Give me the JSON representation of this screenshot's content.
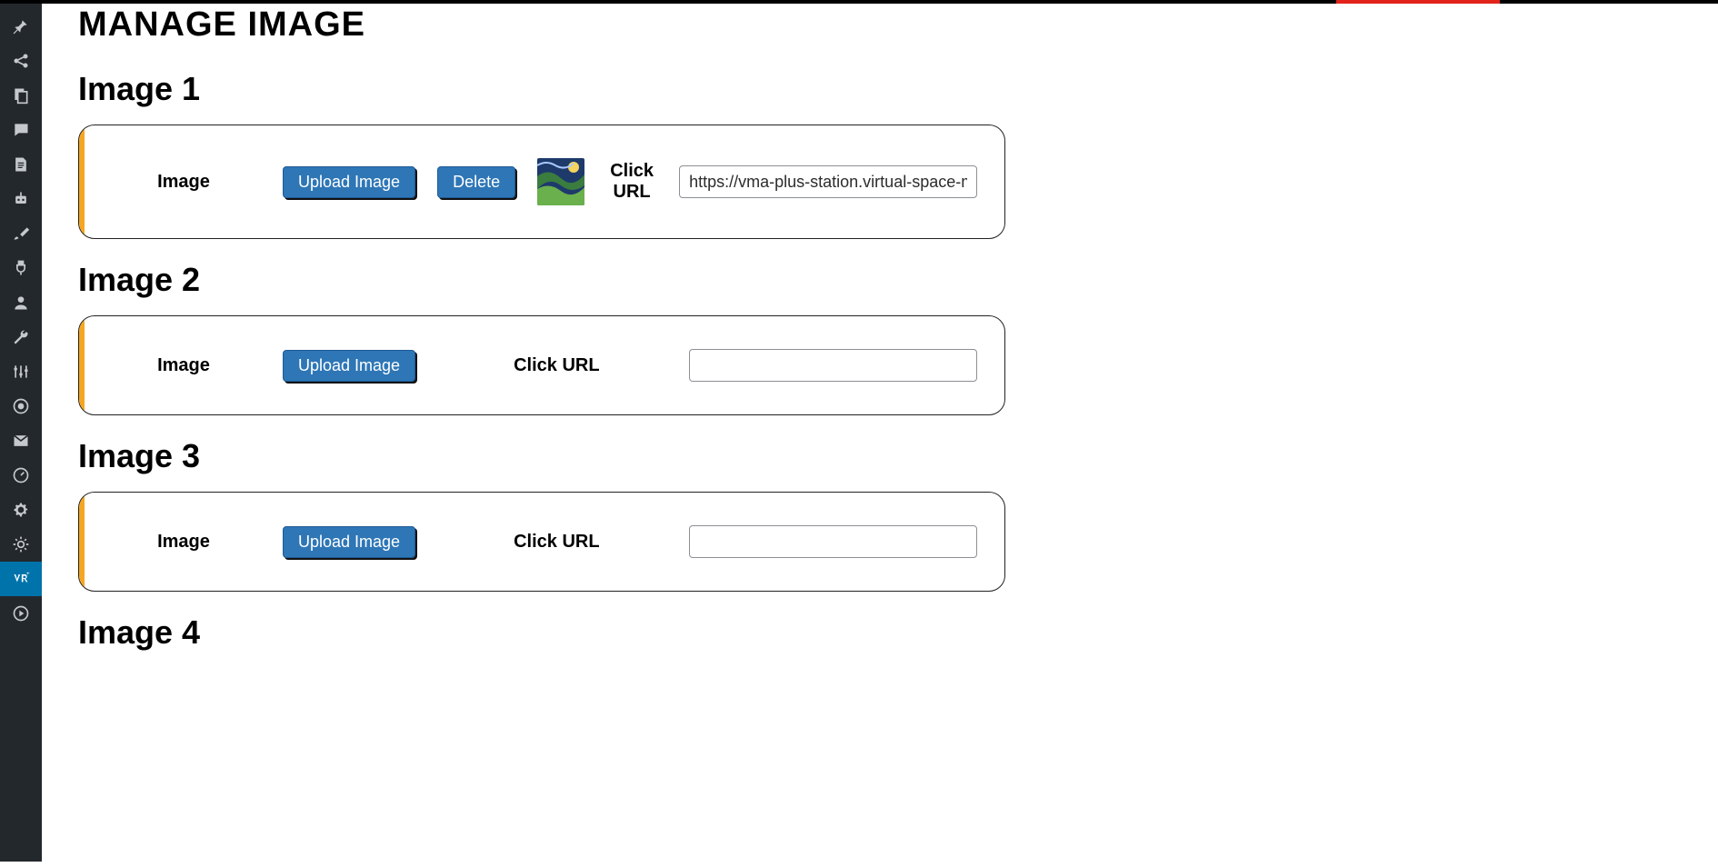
{
  "page": {
    "title": "MANAGE IMAGE"
  },
  "labels": {
    "image": "Image",
    "upload": "Upload Image",
    "delete": "Delete",
    "click_url": "Click URL",
    "click": "Click",
    "url": "URL"
  },
  "sections": [
    {
      "title": "Image 1",
      "has_image": true,
      "url_value": "https://vma-plus-station.virtual-space-marl"
    },
    {
      "title": "Image 2",
      "has_image": false,
      "url_value": ""
    },
    {
      "title": "Image 3",
      "has_image": false,
      "url_value": ""
    },
    {
      "title": "Image 4",
      "has_image": false,
      "url_value": ""
    }
  ],
  "sidebar": {
    "items": [
      "pin-icon",
      "share-icon",
      "pages-icon",
      "speech-icon",
      "document-icon",
      "robot-icon",
      "brush-icon",
      "plug-icon",
      "user-icon",
      "wrench-icon",
      "sliders-icon",
      "target-icon",
      "mail-icon",
      "dashboard-icon",
      "gear-icon",
      "gear2-icon",
      "vr-icon",
      "play-icon"
    ],
    "active_index": 16
  }
}
